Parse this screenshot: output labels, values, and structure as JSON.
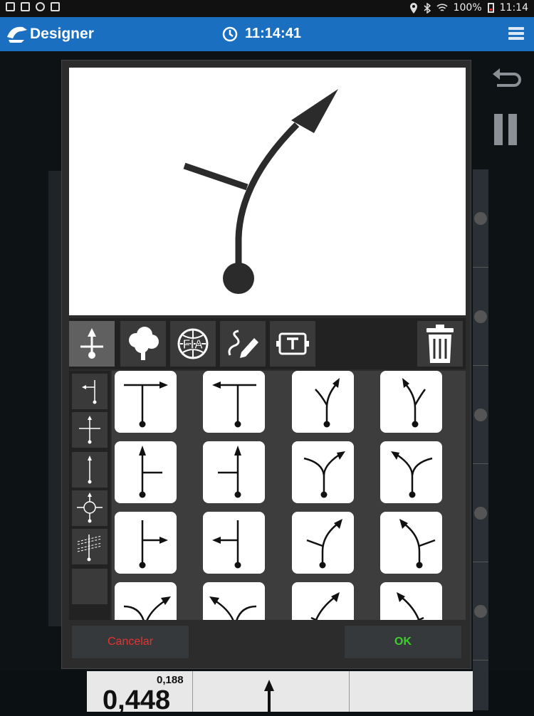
{
  "status_bar": {
    "battery": "100%",
    "time": "11:14",
    "icons": [
      "mail-icon",
      "gallery-icon",
      "target-icon",
      "briefcase-icon",
      "location-icon",
      "bluetooth-icon",
      "wifi-icon",
      "battery-icon"
    ]
  },
  "app_bar": {
    "title": "Designer",
    "clock": "11:14:41",
    "icons": [
      "logo-icon",
      "clock-icon",
      "menu-icon"
    ],
    "color": "#1a6fc1"
  },
  "dialog": {
    "tabs": [
      {
        "name": "road-symbols",
        "icon": "junction-icon",
        "active": true
      },
      {
        "name": "nature",
        "icon": "tree-icon",
        "active": false
      },
      {
        "name": "fia",
        "icon": "fia-icon",
        "active": false
      },
      {
        "name": "draw",
        "icon": "pen-icon",
        "active": false
      },
      {
        "name": "text",
        "icon": "text-box-icon",
        "active": false
      }
    ],
    "trash_icon": "trash-icon",
    "side_categories": [
      "junction-left",
      "crossroads",
      "straight",
      "roundabout",
      "crossing-lines",
      "empty"
    ],
    "symbols": [
      "t-right",
      "t-left",
      "fork-right",
      "fork-left",
      "straight-side-right",
      "straight-side-left",
      "y-right",
      "y-left",
      "t-branch-right",
      "t-branch-left",
      "curve-right-branch",
      "curve-left-branch",
      "bend-right",
      "bend-left",
      "bend-right-alt",
      "bend-left-alt"
    ],
    "cancel_label": "Cancelar",
    "ok_label": "OK",
    "cancel_color": "#e8322f",
    "ok_color": "#3ccf2a"
  },
  "bottom_strip": {
    "small_value": "0,188",
    "big_value": "0,448"
  }
}
